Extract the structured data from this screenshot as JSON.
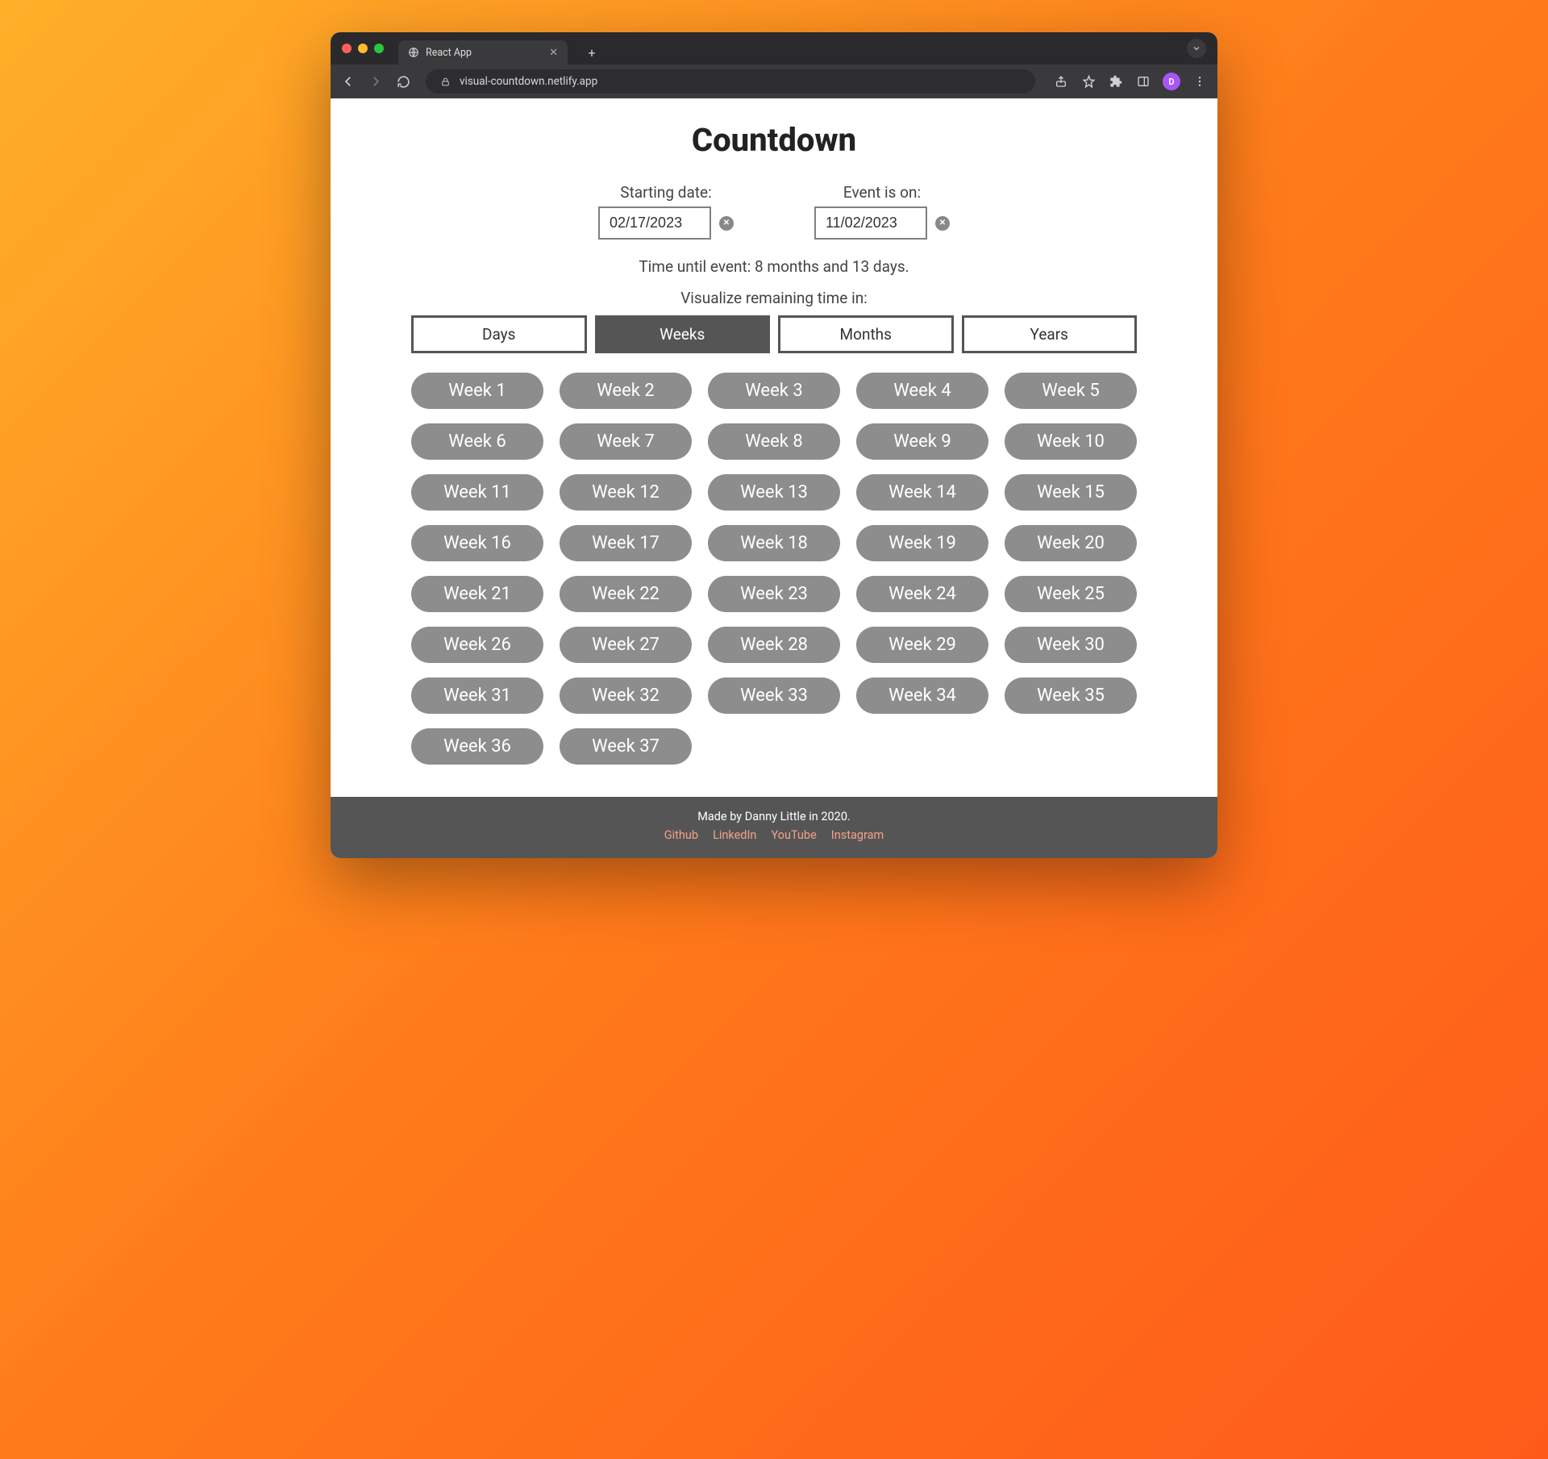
{
  "browser": {
    "tab_title": "React App",
    "url": "visual-countdown.netlify.app",
    "profile_initial": "D"
  },
  "page": {
    "title": "Countdown",
    "start_date_label": "Starting date:",
    "start_date_value": "02/17/2023",
    "event_date_label": "Event is on:",
    "event_date_value": "11/02/2023",
    "time_until": "Time until event: 8 months and 13 days.",
    "visualize_label": "Visualize remaining time in:",
    "tabs": [
      "Days",
      "Weeks",
      "Months",
      "Years"
    ],
    "active_tab": "Weeks",
    "weeks": [
      "Week 1",
      "Week 2",
      "Week 3",
      "Week 4",
      "Week 5",
      "Week 6",
      "Week 7",
      "Week 8",
      "Week 9",
      "Week 10",
      "Week 11",
      "Week 12",
      "Week 13",
      "Week 14",
      "Week 15",
      "Week 16",
      "Week 17",
      "Week 18",
      "Week 19",
      "Week 20",
      "Week 21",
      "Week 22",
      "Week 23",
      "Week 24",
      "Week 25",
      "Week 26",
      "Week 27",
      "Week 28",
      "Week 29",
      "Week 30",
      "Week 31",
      "Week 32",
      "Week 33",
      "Week 34",
      "Week 35",
      "Week 36",
      "Week 37"
    ]
  },
  "footer": {
    "credit": "Made by Danny Little in 2020.",
    "links": [
      "Github",
      "LinkedIn",
      "YouTube",
      "Instagram"
    ]
  }
}
